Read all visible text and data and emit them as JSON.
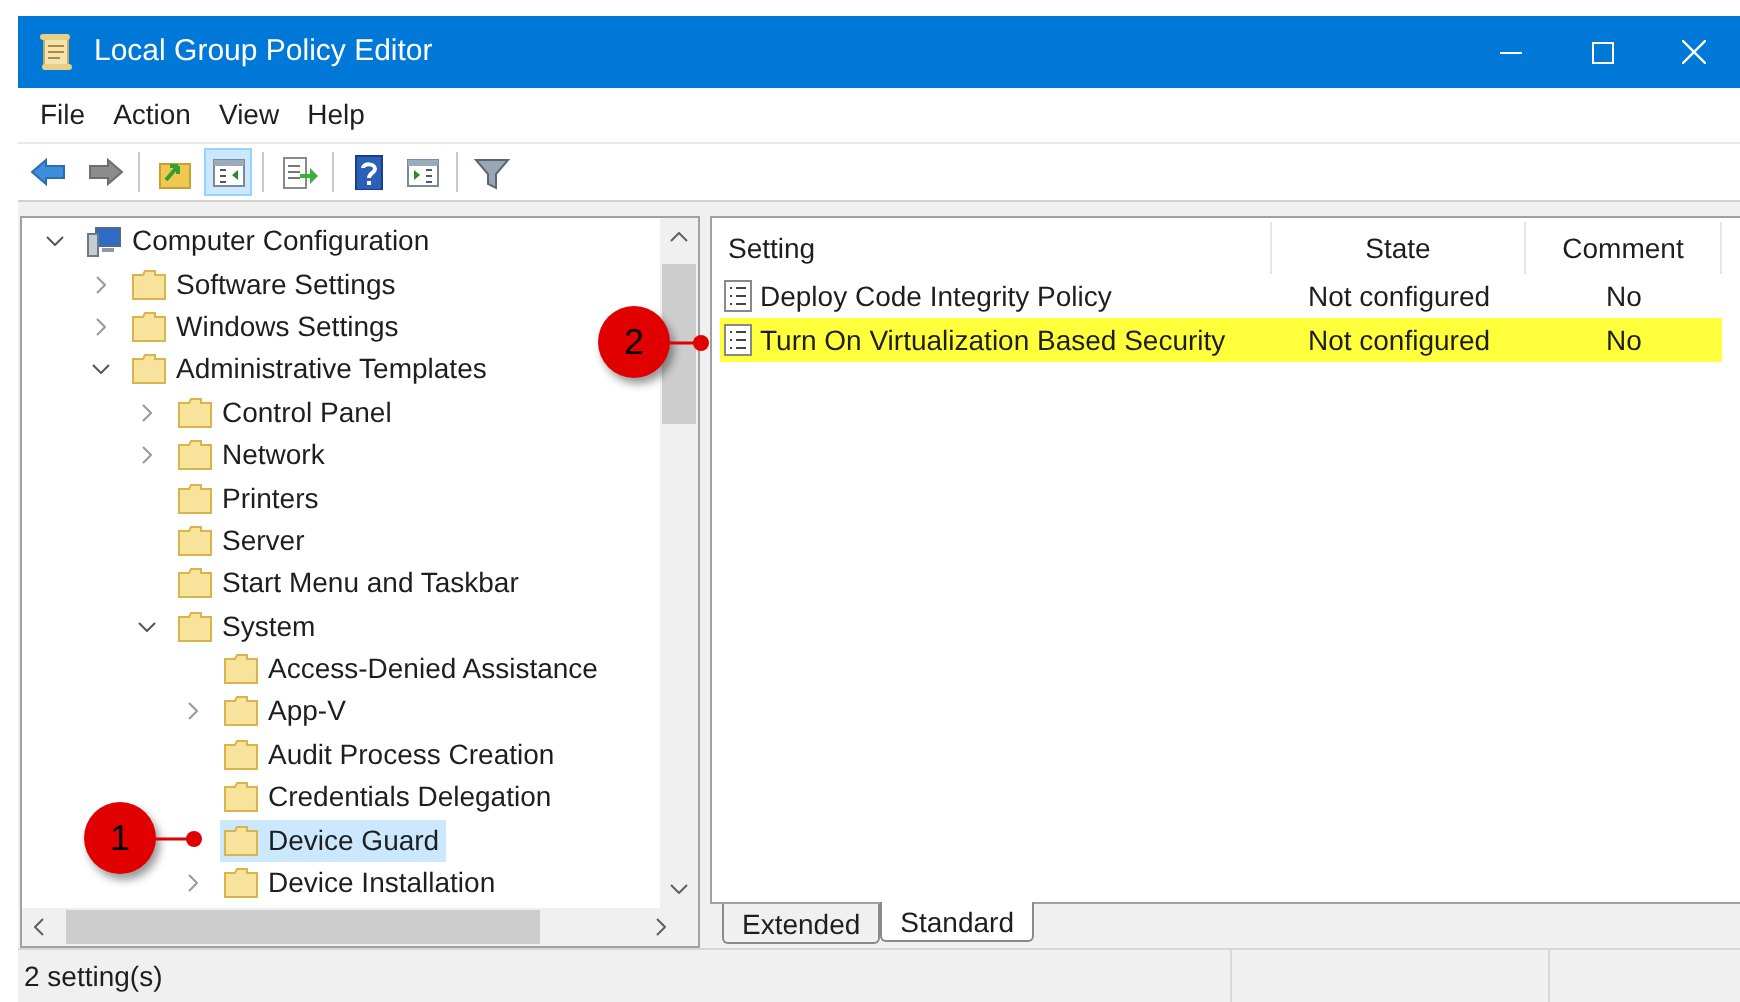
{
  "window": {
    "title": "Local Group Policy Editor"
  },
  "menu": [
    "File",
    "Action",
    "View",
    "Help"
  ],
  "toolbar": [
    {
      "kind": "back",
      "pressed": false
    },
    {
      "kind": "forward",
      "pressed": false
    },
    {
      "kind": "sep"
    },
    {
      "kind": "up",
      "pressed": false
    },
    {
      "kind": "tree",
      "pressed": true
    },
    {
      "kind": "sep"
    },
    {
      "kind": "export",
      "pressed": false
    },
    {
      "kind": "sep"
    },
    {
      "kind": "help",
      "pressed": false
    },
    {
      "kind": "pane",
      "pressed": false
    },
    {
      "kind": "sep"
    },
    {
      "kind": "filter",
      "pressed": false
    }
  ],
  "tree": [
    {
      "label": "Computer Configuration",
      "kind": "expanded",
      "selected": false,
      "children": [
        {
          "label": "Software Settings",
          "kind": "collapsed",
          "selected": false
        },
        {
          "label": "Windows Settings",
          "kind": "collapsed",
          "selected": false
        },
        {
          "label": "Administrative Templates",
          "kind": "expanded",
          "selected": false,
          "children": [
            {
              "label": "Control Panel",
              "kind": "collapsed",
              "selected": false
            },
            {
              "label": "Network",
              "kind": "collapsed",
              "selected": false
            },
            {
              "label": "Printers",
              "kind": "leaf",
              "selected": false
            },
            {
              "label": "Server",
              "kind": "leaf",
              "selected": false
            },
            {
              "label": "Start Menu and Taskbar",
              "kind": "leaf",
              "selected": false
            },
            {
              "label": "System",
              "kind": "expanded",
              "selected": false,
              "children": [
                {
                  "label": "Access-Denied Assistance",
                  "kind": "leaf",
                  "selected": false
                },
                {
                  "label": "App-V",
                  "kind": "collapsed",
                  "selected": false
                },
                {
                  "label": "Audit Process Creation",
                  "kind": "leaf",
                  "selected": false
                },
                {
                  "label": "Credentials Delegation",
                  "kind": "leaf",
                  "selected": false
                },
                {
                  "label": "Device Guard",
                  "kind": "leaf",
                  "selected": true
                },
                {
                  "label": "Device Installation",
                  "kind": "collapsed",
                  "selected": false
                }
              ]
            }
          ]
        }
      ]
    }
  ],
  "table": {
    "columns": [
      "Setting",
      "State",
      "Comment"
    ],
    "rows": [
      {
        "setting": "Deploy Code Integrity Policy",
        "state": "Not configured",
        "comment": "No",
        "highlighted": false
      },
      {
        "setting": "Turn On Virtualization Based Security",
        "state": "Not configured",
        "comment": "No",
        "highlighted": true
      }
    ]
  },
  "tabs": [
    {
      "label": "Extended",
      "selected": false
    },
    {
      "label": "Standard",
      "selected": true
    }
  ],
  "status_bar": "2 setting(s)",
  "callouts": [
    {
      "label": "1"
    },
    {
      "label": "2"
    }
  ]
}
